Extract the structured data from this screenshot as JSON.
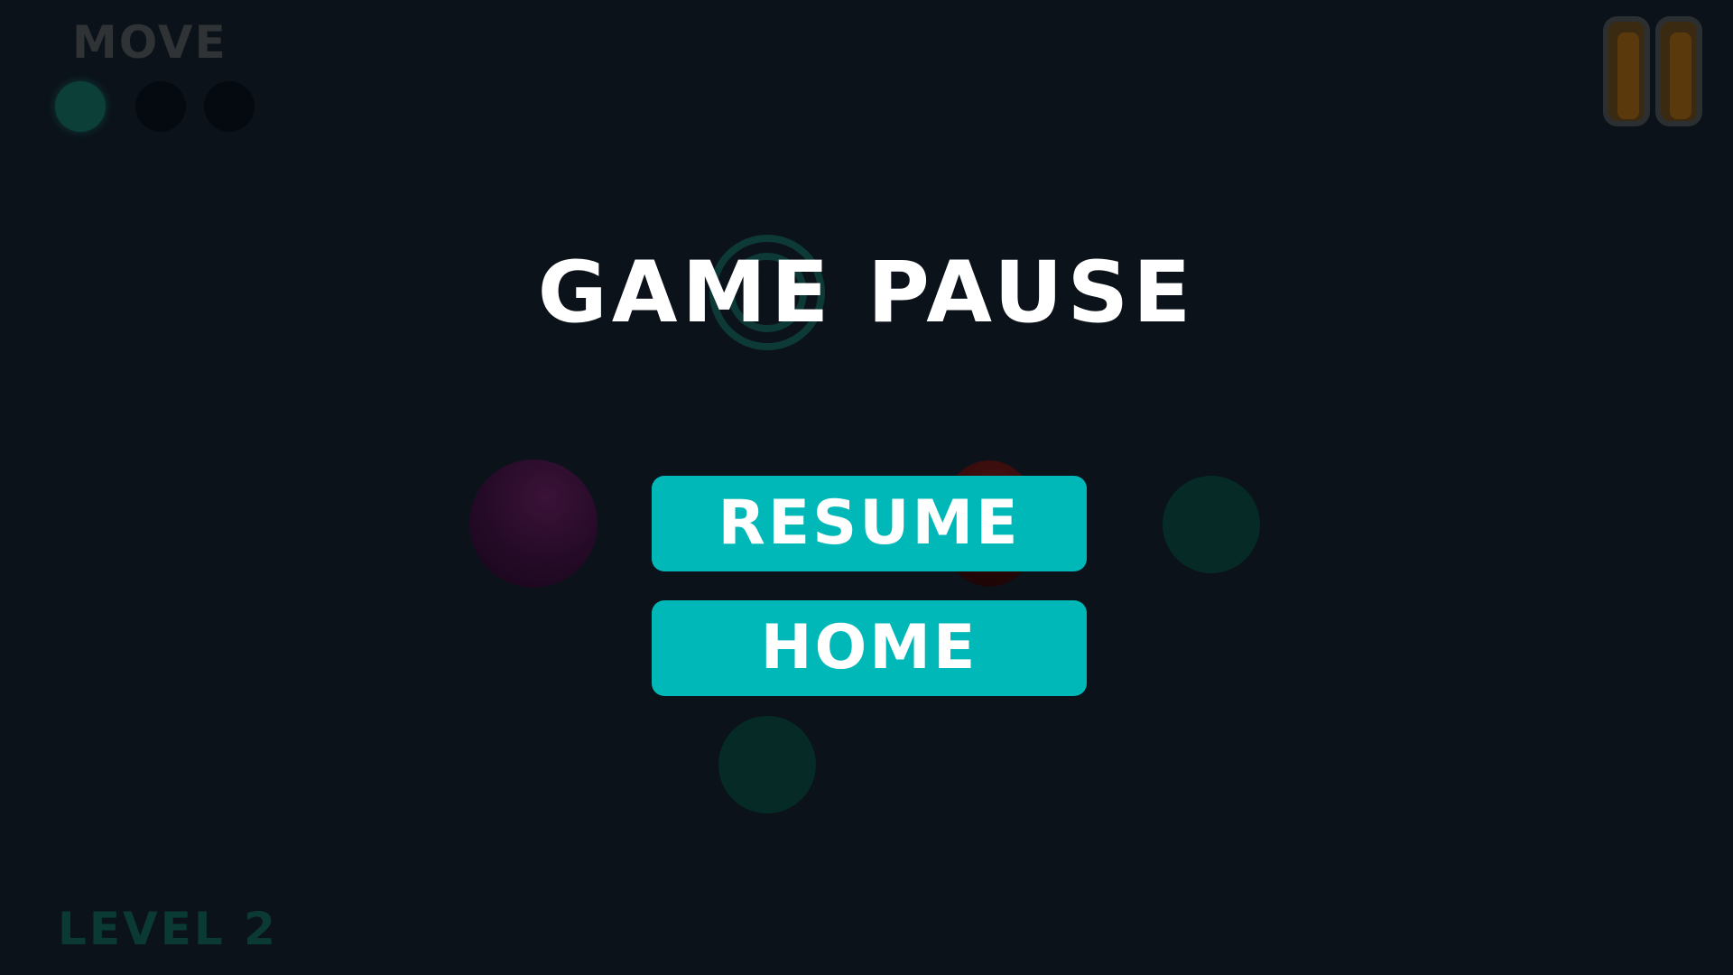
{
  "hud": {
    "move_label": "MOVE",
    "moves_total": 3,
    "moves_active": 1,
    "level_label": "LEVEL 2"
  },
  "pause_menu": {
    "title": "GAME PAUSE",
    "resume_label": "RESUME",
    "home_label": "HOME"
  },
  "icons": {
    "pause": "pause-icon"
  },
  "colors": {
    "background": "#0b121a",
    "button": "#00b8b8",
    "button_text": "#ffffff",
    "title": "#ffffff",
    "pause_icon": "#5a3a0c"
  }
}
